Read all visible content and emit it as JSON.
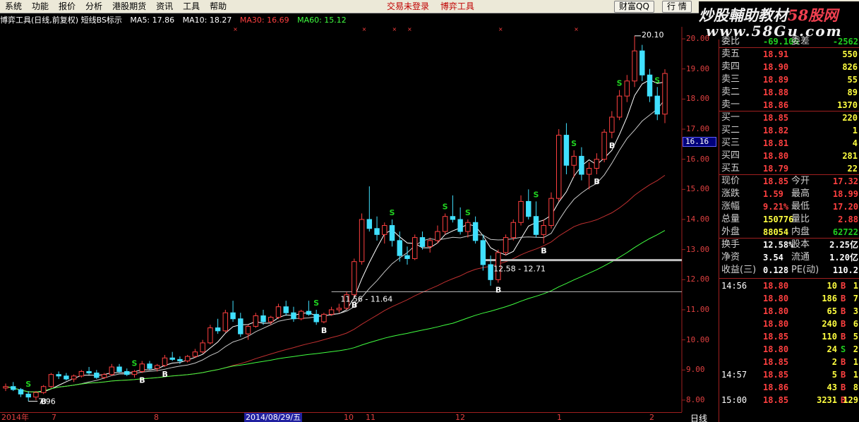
{
  "menu": [
    "系统",
    "功能",
    "报价",
    "分析",
    "港股期货",
    "资讯",
    "工具",
    "帮助"
  ],
  "menu_center": [
    "交易未登录",
    "博弈工具"
  ],
  "buttons": {
    "wealth": "财富QQ",
    "market": "行 情"
  },
  "watermark": {
    "title_prefix": "炒股輔助教材",
    "brand": "58股网",
    "url": "www.58Gu.com"
  },
  "chart_header": {
    "title": "博弈工具(日线,前复权) 短线BS标示",
    "ma5": "MA5: 17.86",
    "ma10": "MA10: 18.27",
    "ma30": "MA30: 16.69",
    "ma60": "MA60: 15.12",
    "colors": {
      "ma5": "#ffffff",
      "ma10": "#ffffff",
      "ma30": "#ff4040",
      "ma60": "#40ff40"
    }
  },
  "price_axis": [
    "20.00",
    "19.00",
    "18.00",
    "17.00",
    "16.00",
    "15.00",
    "14.00",
    "13.00",
    "12.00",
    "11.00",
    "10.00",
    "9.00",
    "8.00"
  ],
  "current_price_tag": "16.16",
  "annotations": {
    "high": "20.10",
    "low": "7.96",
    "zone1": "11.56 - 11.64",
    "zone2": "12.58 - 12.71"
  },
  "date_axis": {
    "labels": [
      "2014年",
      "7",
      "8",
      "10",
      "11",
      "12",
      "1",
      "2"
    ],
    "cursor": "2014/08/29/五",
    "period": "日线"
  },
  "chart_data": {
    "type": "candlestick",
    "price_unit": "CNY",
    "ylim": [
      7.6,
      20.4
    ],
    "ohlc": [
      [
        8.4,
        8.55,
        8.3,
        8.45
      ],
      [
        8.45,
        8.6,
        8.3,
        8.35
      ],
      [
        8.35,
        8.4,
        8.1,
        8.2
      ],
      [
        8.2,
        8.3,
        7.96,
        8.1
      ],
      [
        8.1,
        8.3,
        8.0,
        8.25
      ],
      [
        8.25,
        8.5,
        8.2,
        8.45
      ],
      [
        8.45,
        8.9,
        8.4,
        8.85
      ],
      [
        8.85,
        8.95,
        8.7,
        8.8
      ],
      [
        8.8,
        8.9,
        8.65,
        8.7
      ],
      [
        8.7,
        8.85,
        8.6,
        8.8
      ],
      [
        8.8,
        9.0,
        8.75,
        8.95
      ],
      [
        8.95,
        9.1,
        8.85,
        8.9
      ],
      [
        8.9,
        9.0,
        8.7,
        8.75
      ],
      [
        8.75,
        8.9,
        8.7,
        8.85
      ],
      [
        8.85,
        9.2,
        8.8,
        9.1
      ],
      [
        9.1,
        9.2,
        8.9,
        8.95
      ],
      [
        8.95,
        9.05,
        8.8,
        8.85
      ],
      [
        8.85,
        9.0,
        8.75,
        8.95
      ],
      [
        8.95,
        9.3,
        8.9,
        9.2
      ],
      [
        9.2,
        9.3,
        9.0,
        9.05
      ],
      [
        9.05,
        9.2,
        8.95,
        9.15
      ],
      [
        9.15,
        9.5,
        9.1,
        9.4
      ],
      [
        9.4,
        9.6,
        9.3,
        9.35
      ],
      [
        9.35,
        9.45,
        9.2,
        9.3
      ],
      [
        9.3,
        9.5,
        9.25,
        9.45
      ],
      [
        9.45,
        9.7,
        9.4,
        9.6
      ],
      [
        9.6,
        10.0,
        9.55,
        9.9
      ],
      [
        9.9,
        10.5,
        9.85,
        10.4
      ],
      [
        10.4,
        10.7,
        10.2,
        10.3
      ],
      [
        10.3,
        11.0,
        10.25,
        10.9
      ],
      [
        10.9,
        11.3,
        10.6,
        10.7
      ],
      [
        10.7,
        10.9,
        10.1,
        10.2
      ],
      [
        10.2,
        10.5,
        10.0,
        10.45
      ],
      [
        10.45,
        10.9,
        10.4,
        10.8
      ],
      [
        10.8,
        11.0,
        10.5,
        10.6
      ],
      [
        10.6,
        10.8,
        10.5,
        10.75
      ],
      [
        10.75,
        11.2,
        10.7,
        11.1
      ],
      [
        11.1,
        11.3,
        10.8,
        10.9
      ],
      [
        10.9,
        11.1,
        10.6,
        10.7
      ],
      [
        10.7,
        11.0,
        10.65,
        10.95
      ],
      [
        10.95,
        11.3,
        10.8,
        10.85
      ],
      [
        10.85,
        11.0,
        10.5,
        10.6
      ],
      [
        10.6,
        10.9,
        10.55,
        10.85
      ],
      [
        10.85,
        11.1,
        10.8,
        11.0
      ],
      [
        11.0,
        11.2,
        10.9,
        11.05
      ],
      [
        11.05,
        11.6,
        11.0,
        11.5
      ],
      [
        11.5,
        12.7,
        11.4,
        12.6
      ],
      [
        12.6,
        14.2,
        12.5,
        14.0
      ],
      [
        14.0,
        15.1,
        13.6,
        13.7
      ],
      [
        13.7,
        14.1,
        13.3,
        13.5
      ],
      [
        13.5,
        13.9,
        13.2,
        13.8
      ],
      [
        13.8,
        14.0,
        13.1,
        13.3
      ],
      [
        13.3,
        13.6,
        12.6,
        12.8
      ],
      [
        12.8,
        13.1,
        12.5,
        12.7
      ],
      [
        12.7,
        13.5,
        12.65,
        13.4
      ],
      [
        13.4,
        13.6,
        13.0,
        13.1
      ],
      [
        13.1,
        13.4,
        12.9,
        13.3
      ],
      [
        13.3,
        13.8,
        13.2,
        13.6
      ],
      [
        13.6,
        14.2,
        13.5,
        14.1
      ],
      [
        14.1,
        14.8,
        13.9,
        14.0
      ],
      [
        14.0,
        14.4,
        13.5,
        13.6
      ],
      [
        13.6,
        14.0,
        13.4,
        13.9
      ],
      [
        13.9,
        14.1,
        13.2,
        13.3
      ],
      [
        13.3,
        13.5,
        12.3,
        12.5
      ],
      [
        12.5,
        12.8,
        11.8,
        12.0
      ],
      [
        12.0,
        13.0,
        11.9,
        12.9
      ],
      [
        12.9,
        13.5,
        12.8,
        13.4
      ],
      [
        13.4,
        14.0,
        13.3,
        13.9
      ],
      [
        13.9,
        14.8,
        13.8,
        14.6
      ],
      [
        14.6,
        15.0,
        14.0,
        14.1
      ],
      [
        14.1,
        14.6,
        13.4,
        13.5
      ],
      [
        13.5,
        14.0,
        13.2,
        13.8
      ],
      [
        13.8,
        14.9,
        13.7,
        14.7
      ],
      [
        14.7,
        17.0,
        14.6,
        16.8
      ],
      [
        16.8,
        17.2,
        15.5,
        15.8
      ],
      [
        15.8,
        16.3,
        15.4,
        16.1
      ],
      [
        16.1,
        16.4,
        15.3,
        15.5
      ],
      [
        15.5,
        15.9,
        15.0,
        15.7
      ],
      [
        15.7,
        16.2,
        15.5,
        16.0
      ],
      [
        16.0,
        17.0,
        15.9,
        16.9
      ],
      [
        16.9,
        17.6,
        16.7,
        17.4
      ],
      [
        17.4,
        18.3,
        17.3,
        18.1
      ],
      [
        18.1,
        18.8,
        17.9,
        18.6
      ],
      [
        18.6,
        20.1,
        18.4,
        19.6
      ],
      [
        19.6,
        19.8,
        18.6,
        18.8
      ],
      [
        18.8,
        19.0,
        17.9,
        18.1
      ],
      [
        18.1,
        18.4,
        17.3,
        17.5
      ],
      [
        17.5,
        18.99,
        17.2,
        18.85
      ]
    ],
    "bs_signals": [
      {
        "i": 3,
        "s": "S"
      },
      {
        "i": 5,
        "s": "B"
      },
      {
        "i": 17,
        "s": "S"
      },
      {
        "i": 18,
        "s": "B"
      },
      {
        "i": 21,
        "s": "B"
      },
      {
        "i": 41,
        "s": "S"
      },
      {
        "i": 42,
        "s": "B"
      },
      {
        "i": 46,
        "s": "B"
      },
      {
        "i": 51,
        "s": "S"
      },
      {
        "i": 58,
        "s": "S"
      },
      {
        "i": 61,
        "s": "S"
      },
      {
        "i": 65,
        "s": "B"
      },
      {
        "i": 70,
        "s": "S"
      },
      {
        "i": 71,
        "s": "B"
      },
      {
        "i": 75,
        "s": "S"
      },
      {
        "i": 78,
        "s": "B"
      },
      {
        "i": 81,
        "s": "S"
      },
      {
        "i": 80,
        "s": "B"
      },
      {
        "i": 86,
        "s": "S"
      }
    ],
    "ma_colors": {
      "ma5": "#ffffff",
      "ma10": "#ffffff",
      "ma30": "#ff4040",
      "ma60": "#40ff40"
    },
    "candle_colors": {
      "up": "#ff4040",
      "down": "#40e0ff"
    },
    "hlines": [
      11.6,
      12.65
    ]
  },
  "order_book": {
    "header": {
      "k1": "委比",
      "v1": "-69.10%",
      "k2": "委差",
      "v2": "-2562"
    },
    "sell": [
      {
        "label": "卖五",
        "price": "18.91",
        "qty": "550"
      },
      {
        "label": "卖四",
        "price": "18.90",
        "qty": "826"
      },
      {
        "label": "卖三",
        "price": "18.89",
        "qty": "55"
      },
      {
        "label": "卖二",
        "price": "18.88",
        "qty": "89"
      },
      {
        "label": "卖一",
        "price": "18.86",
        "qty": "1370"
      }
    ],
    "buy": [
      {
        "label": "买一",
        "price": "18.85",
        "qty": "220"
      },
      {
        "label": "买二",
        "price": "18.82",
        "qty": "1"
      },
      {
        "label": "买三",
        "price": "18.81",
        "qty": "4"
      },
      {
        "label": "买四",
        "price": "18.80",
        "qty": "281"
      },
      {
        "label": "买五",
        "price": "18.79",
        "qty": "22"
      }
    ]
  },
  "quote": [
    {
      "k1": "现价",
      "v1": "18.85",
      "k2": "今开",
      "v2": "17.32"
    },
    {
      "k1": "涨跌",
      "v1": "1.59",
      "k2": "最高",
      "v2": "18.99"
    },
    {
      "k1": "涨幅",
      "v1": "9.21%",
      "k2": "最低",
      "v2": "17.20"
    },
    {
      "k1": "总量",
      "v1": "150776",
      "k2": "量比",
      "v2": "2.88"
    },
    {
      "k1": "外盘",
      "v1": "88054",
      "k2": "内盘",
      "v2": "62722"
    },
    {
      "k1": "换手",
      "v1": "12.58%",
      "k2": "股本",
      "v2": "2.25亿"
    },
    {
      "k1": "净资",
      "v1": "3.54",
      "k2": "流通",
      "v2": "1.20亿"
    },
    {
      "k1": "收益(三)",
      "v1": "0.128",
      "k2": "PE(动)",
      "v2": "110.2"
    }
  ],
  "ticks": [
    {
      "t": "14:56",
      "p": "18.80",
      "v": "10",
      "s": "B",
      "n": "1"
    },
    {
      "t": "",
      "p": "18.80",
      "v": "186",
      "s": "B",
      "n": "7"
    },
    {
      "t": "",
      "p": "18.80",
      "v": "65",
      "s": "B",
      "n": "3"
    },
    {
      "t": "",
      "p": "18.80",
      "v": "240",
      "s": "B",
      "n": "6"
    },
    {
      "t": "",
      "p": "18.85",
      "v": "110",
      "s": "B",
      "n": "5"
    },
    {
      "t": "",
      "p": "18.80",
      "v": "24",
      "s": "S",
      "n": "2"
    },
    {
      "t": "",
      "p": "18.85",
      "v": "2",
      "s": "B",
      "n": "1"
    },
    {
      "t": "14:57",
      "p": "18.85",
      "v": "5",
      "s": "B",
      "n": "1"
    },
    {
      "t": "",
      "p": "18.86",
      "v": "43",
      "s": "B",
      "n": "8"
    },
    {
      "t": "15:00",
      "p": "18.85",
      "v": "3231",
      "s": "B",
      "n": "129"
    }
  ]
}
